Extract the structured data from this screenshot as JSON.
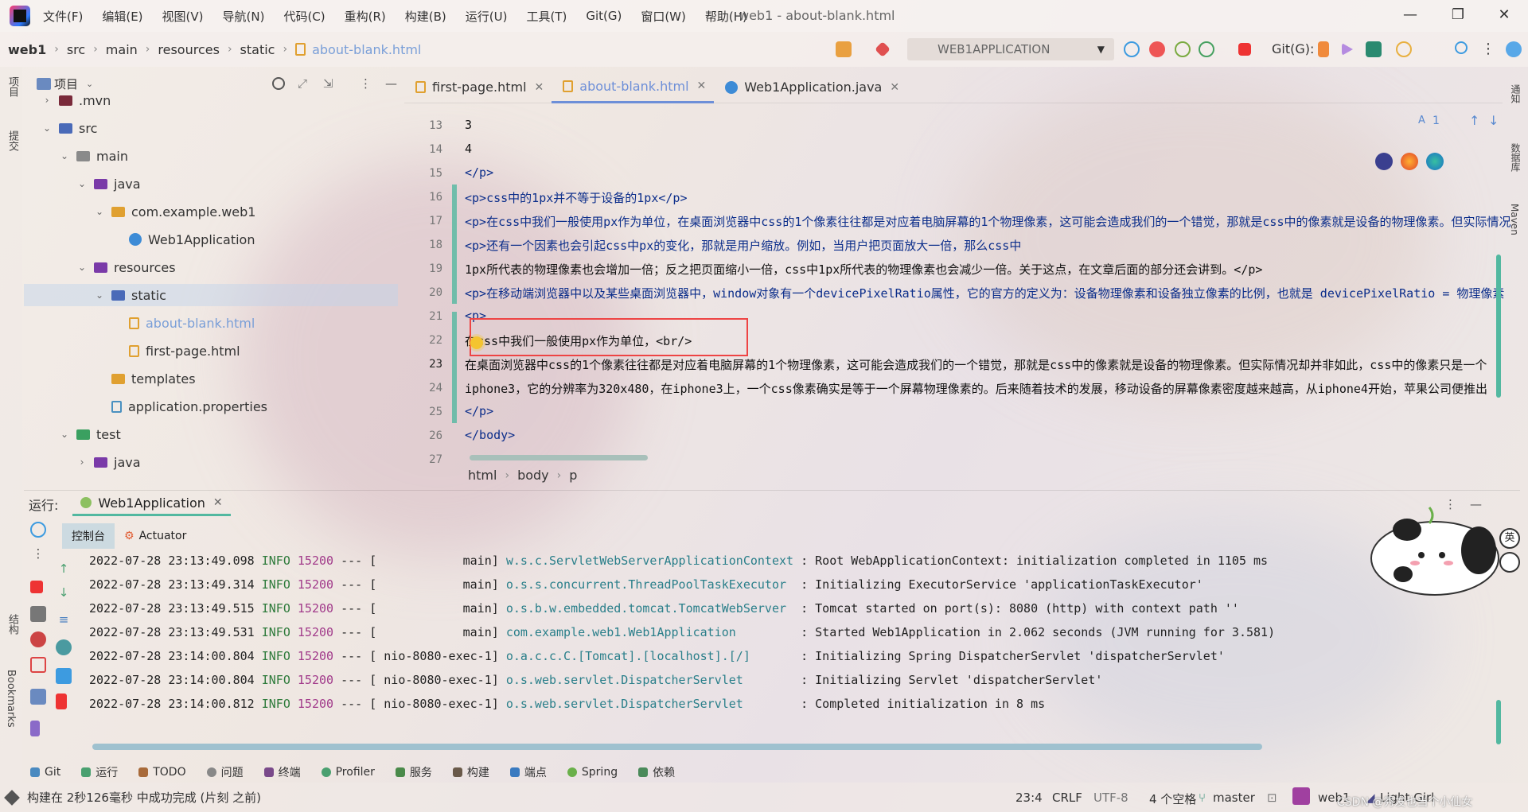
{
  "window": {
    "title": "web1 - about-blank.html",
    "menu": [
      "文件(F)",
      "编辑(E)",
      "视图(V)",
      "导航(N)",
      "代码(C)",
      "重构(R)",
      "构建(B)",
      "运行(U)",
      "工具(T)",
      "Git(G)",
      "窗口(W)",
      "帮助(H)"
    ],
    "min": "—",
    "max": "❐",
    "close": "✕"
  },
  "navbar": {
    "project": "web1",
    "crumbs": [
      "src",
      "main",
      "resources",
      "static",
      "about-blank.html"
    ],
    "run_config": "WEB1APPLICATION",
    "git_label": "Git(G):"
  },
  "left_stripe": {
    "project": "项目",
    "commit": "提交",
    "structure": "结构",
    "bookmarks": "Bookmarks"
  },
  "right_stripe": {
    "notifications": "通知",
    "database": "数据库",
    "maven": "Maven"
  },
  "project_panel": {
    "title": "项目",
    "tree": [
      {
        "label": ".mvn",
        "depth": 1,
        "arrow": "›",
        "icon": "folder-dark"
      },
      {
        "label": "src",
        "depth": 1,
        "arrow": "⌄",
        "icon": "folder-blue"
      },
      {
        "label": "main",
        "depth": 2,
        "arrow": "⌄",
        "icon": "folder-gray"
      },
      {
        "label": "java",
        "depth": 3,
        "arrow": "⌄",
        "icon": "folder-purple"
      },
      {
        "label": "com.example.web1",
        "depth": 4,
        "arrow": "⌄",
        "icon": "folder-yellow"
      },
      {
        "label": "Web1Application",
        "depth": 5,
        "arrow": "",
        "icon": "java-class"
      },
      {
        "label": "resources",
        "depth": 3,
        "arrow": "⌄",
        "icon": "folder-purple"
      },
      {
        "label": "static",
        "depth": 4,
        "arrow": "⌄",
        "icon": "folder-blue"
      },
      {
        "label": "about-blank.html",
        "depth": 5,
        "arrow": "",
        "icon": "html-file"
      },
      {
        "label": "first-page.html",
        "depth": 5,
        "arrow": "",
        "icon": "html-file"
      },
      {
        "label": "templates",
        "depth": 4,
        "arrow": "",
        "icon": "folder-yellow"
      },
      {
        "label": "application.properties",
        "depth": 4,
        "arrow": "",
        "icon": "properties-file"
      },
      {
        "label": "test",
        "depth": 2,
        "arrow": "⌄",
        "icon": "folder-green"
      },
      {
        "label": "java",
        "depth": 3,
        "arrow": "›",
        "icon": "folder-purple"
      }
    ]
  },
  "editor": {
    "tabs": [
      {
        "label": "first-page.html",
        "close": "✕"
      },
      {
        "label": "about-blank.html",
        "close": "✕"
      },
      {
        "label": "Web1Application.java",
        "close": "✕"
      }
    ],
    "match_count": "1",
    "lines": [
      {
        "n": "13",
        "text": "3"
      },
      {
        "n": "14",
        "text": "4"
      },
      {
        "n": "15",
        "text": "</p>"
      },
      {
        "n": "16",
        "text": "<p>css中的1px并不等于设备的1px</p>"
      },
      {
        "n": "17",
        "text": "<p>在css中我们一般使用px作为单位，在桌面浏览器中css的1个像素往往都是对应着电脑屏幕的1个物理像素，这可能会造成我们的一个错觉，那就是css中的像素就是设备的物理像素。但实际情况"
      },
      {
        "n": "18",
        "text": "<p>还有一个因素也会引起css中px的变化，那就是用户缩放。例如，当用户把页面放大一倍，那么css中"
      },
      {
        "n": "19",
        "text": "    1px所代表的物理像素也会增加一倍；反之把页面缩小一倍，css中1px所代表的物理像素也会减少一倍。关于这点，在文章后面的部分还会讲到。</p>"
      },
      {
        "n": "20",
        "text": "<p>在移动端浏览器中以及某些桌面浏览器中，window对象有一个devicePixelRatio属性，它的官方的定义为：设备物理像素和设备独立像素的比例，也就是 devicePixelRatio = 物理像素"
      },
      {
        "n": "21",
        "text": "<p>"
      },
      {
        "n": "22",
        "text": "    在css中我们一般使用px作为单位，<br/>"
      },
      {
        "n": "23",
        "text": "    在桌面浏览器中css的1个像素往往都是对应着电脑屏幕的1个物理像素，这可能会造成我们的一个错觉，那就是css中的像素就是设备的物理像素。但实际情况却并非如此，css中的像素只是一个"
      },
      {
        "n": "24",
        "text": "    iphone3，它的分辨率为320x480，在iphone3上，一个css像素确实是等于一个屏幕物理像素的。后来随着技术的发展，移动设备的屏幕像素密度越来越高，从iphone4开始，苹果公司便推出"
      },
      {
        "n": "25",
        "text": "</p>"
      },
      {
        "n": "26",
        "text": "</body>"
      },
      {
        "n": "27",
        "text": ""
      }
    ],
    "breadcrumb": [
      "html",
      "body",
      "p"
    ]
  },
  "run_panel": {
    "label": "运行:",
    "tab": "Web1Application",
    "tab_close": "✕",
    "subtabs": [
      "控制台",
      "Actuator"
    ],
    "logs": [
      {
        "ts": "2022-07-28 23:13:49.098",
        "lvl": "INFO",
        "pid": "15200",
        "sep": "--- [",
        "thread": "           main]",
        "logger": "w.s.c.ServletWebServerApplicationContext",
        "msg": ": Root WebApplicationContext: initialization completed in 1105 ms"
      },
      {
        "ts": "2022-07-28 23:13:49.314",
        "lvl": "INFO",
        "pid": "15200",
        "sep": "--- [",
        "thread": "           main]",
        "logger": "o.s.s.concurrent.ThreadPoolTaskExecutor ",
        "msg": ": Initializing ExecutorService 'applicationTaskExecutor'"
      },
      {
        "ts": "2022-07-28 23:13:49.515",
        "lvl": "INFO",
        "pid": "15200",
        "sep": "--- [",
        "thread": "           main]",
        "logger": "o.s.b.w.embedded.tomcat.TomcatWebServer ",
        "msg": ": Tomcat started on port(s): 8080 (http) with context path ''"
      },
      {
        "ts": "2022-07-28 23:13:49.531",
        "lvl": "INFO",
        "pid": "15200",
        "sep": "--- [",
        "thread": "           main]",
        "logger": "com.example.web1.Web1Application        ",
        "msg": ": Started Web1Application in 2.062 seconds (JVM running for 3.581)"
      },
      {
        "ts": "2022-07-28 23:14:00.804",
        "lvl": "INFO",
        "pid": "15200",
        "sep": "--- [",
        "thread": "nio-8080-exec-1]",
        "logger": "o.a.c.c.C.[Tomcat].[localhost].[/]      ",
        "msg": ": Initializing Spring DispatcherServlet 'dispatcherServlet'"
      },
      {
        "ts": "2022-07-28 23:14:00.804",
        "lvl": "INFO",
        "pid": "15200",
        "sep": "--- [",
        "thread": "nio-8080-exec-1]",
        "logger": "o.s.web.servlet.DispatcherServlet       ",
        "msg": ": Initializing Servlet 'dispatcherServlet'"
      },
      {
        "ts": "2022-07-28 23:14:00.812",
        "lvl": "INFO",
        "pid": "15200",
        "sep": "--- [",
        "thread": "nio-8080-exec-1]",
        "logger": "o.s.web.servlet.DispatcherServlet       ",
        "msg": ": Completed initialization in 8 ms"
      }
    ]
  },
  "tool_windows": [
    "Git",
    "运行",
    "TODO",
    "问题",
    "终端",
    "Profiler",
    "服务",
    "构建",
    "端点",
    "Spring",
    "依赖"
  ],
  "status_bar": {
    "message": "构建在 2秒126毫秒 中成功完成 (片刻 之前)",
    "position": "23:4",
    "line_sep": "CRLF",
    "encoding": "UTF-8",
    "indent": "4 个空格",
    "branch": "master",
    "project": "web1",
    "theme": "Light Girl",
    "watermark": "CSDN @秀发也当个小仙女"
  },
  "ime": {
    "lang": "英"
  },
  "colors": {
    "accent": "#52b8a0",
    "tag": "#0b2d8a",
    "highlight_box": "#ee4444",
    "active_tab": "#6d8fd8"
  }
}
